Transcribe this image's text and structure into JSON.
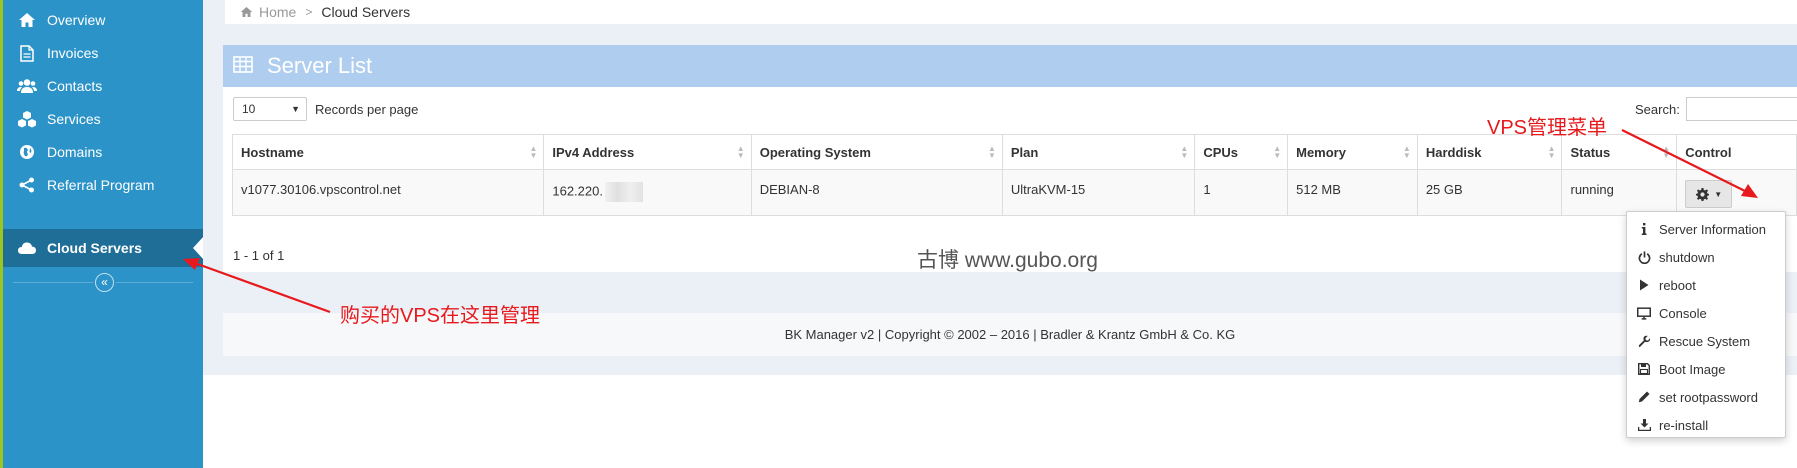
{
  "sidebar": {
    "items": [
      {
        "label": "Overview",
        "icon": "home-icon"
      },
      {
        "label": "Invoices",
        "icon": "document-icon"
      },
      {
        "label": "Contacts",
        "icon": "users-icon"
      },
      {
        "label": "Services",
        "icon": "cubes-icon"
      },
      {
        "label": "Domains",
        "icon": "globe-icon"
      },
      {
        "label": "Referral Program",
        "icon": "share-icon"
      },
      {
        "label": "Cloud Servers",
        "icon": "cloud-icon",
        "active": true
      }
    ],
    "collapse_glyph": "«"
  },
  "breadcrumb": {
    "home": "Home",
    "separator": ">",
    "current": "Cloud Servers"
  },
  "panel": {
    "title": "Server List"
  },
  "records": {
    "value": "10",
    "label": "Records per page"
  },
  "search": {
    "label": "Search:"
  },
  "table": {
    "columns": [
      "Hostname",
      "IPv4 Address",
      "Operating System",
      "Plan",
      "CPUs",
      "Memory",
      "Harddisk",
      "Status",
      "Control"
    ],
    "rows": [
      {
        "hostname": "v1077.30106.vpscontrol.net",
        "ipv4": "162.220.",
        "os": "DEBIAN-8",
        "plan": "UltraKVM-15",
        "cpus": "1",
        "memory": "512 MB",
        "harddisk": "25 GB",
        "status": "running"
      }
    ]
  },
  "count": "1 - 1 of 1",
  "dropdown": {
    "items": [
      {
        "label": "Server Information",
        "icon": "info-icon"
      },
      {
        "label": "shutdown",
        "icon": "power-icon"
      },
      {
        "label": "reboot",
        "icon": "play-icon"
      },
      {
        "label": "Console",
        "icon": "monitor-icon"
      },
      {
        "label": "Rescue System",
        "icon": "wrench-icon"
      },
      {
        "label": "Boot Image",
        "icon": "floppy-icon"
      },
      {
        "label": "set rootpassword",
        "icon": "pencil-icon"
      },
      {
        "label": "re-install",
        "icon": "download-icon"
      }
    ]
  },
  "footer": "BK Manager v2 | Copyright © 2002 – 2016 | Bradler & Krantz GmbH & Co. KG",
  "watermark": "古博 www.gubo.org",
  "annotations": {
    "vps_menu": "VPS管理菜单",
    "manage_here": "购买的VPS在这里管理"
  },
  "colors": {
    "sidebar": "#2b93c7",
    "sidebar_active": "#1f6e98",
    "panel_header": "#afcdef",
    "annotation": "#e8191d"
  }
}
